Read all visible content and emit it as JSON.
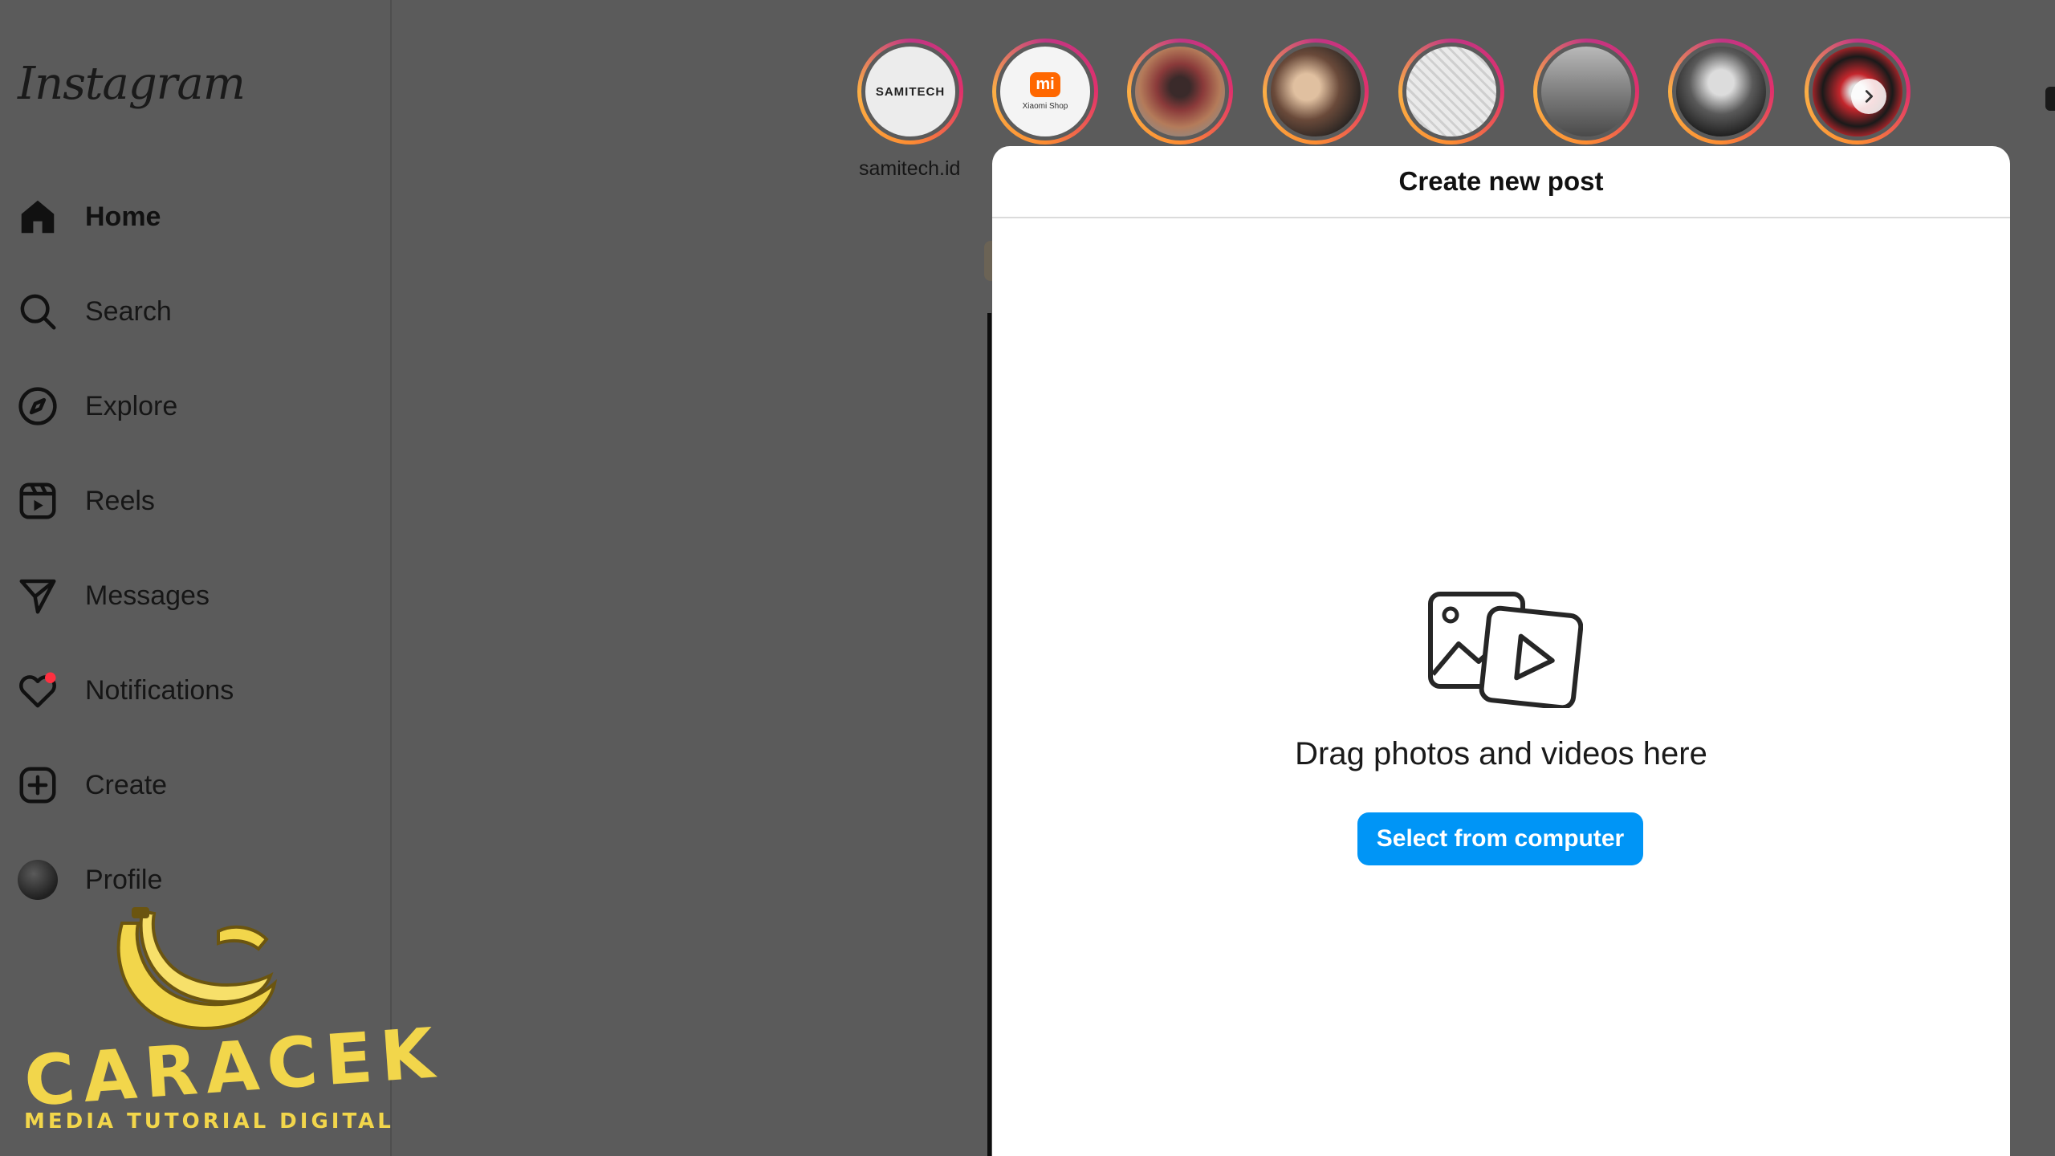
{
  "app": {
    "logo_text": "Instagram"
  },
  "sidebar": {
    "items": [
      {
        "id": "home",
        "label": "Home",
        "icon": "home-icon",
        "active": true
      },
      {
        "id": "search",
        "label": "Search",
        "icon": "search-icon"
      },
      {
        "id": "explore",
        "label": "Explore",
        "icon": "compass-icon"
      },
      {
        "id": "reels",
        "label": "Reels",
        "icon": "reels-icon"
      },
      {
        "id": "messages",
        "label": "Messages",
        "icon": "paper-plane-icon"
      },
      {
        "id": "notifications",
        "label": "Notifications",
        "icon": "heart-icon",
        "badge_color": "#ff3040"
      },
      {
        "id": "create",
        "label": "Create",
        "icon": "plus-square-icon"
      },
      {
        "id": "profile",
        "label": "Profile",
        "icon": "avatar"
      }
    ]
  },
  "stories": {
    "first_username": "samitech.id",
    "first_logo_text": "SAMITECH",
    "second_logo_text": "mi",
    "second_caption": "Xiaomi Shop"
  },
  "modal": {
    "title": "Create new post",
    "prompt": "Drag photos and videos here",
    "button_label": "Select from computer"
  },
  "watermark": {
    "title": "CARACEK",
    "subtitle": "MEDIA TUTORIAL DIGITAL"
  },
  "colors": {
    "accent": "#0095f6",
    "overlay_bg": "#5b5b5b",
    "watermark": "#f2d64b"
  }
}
